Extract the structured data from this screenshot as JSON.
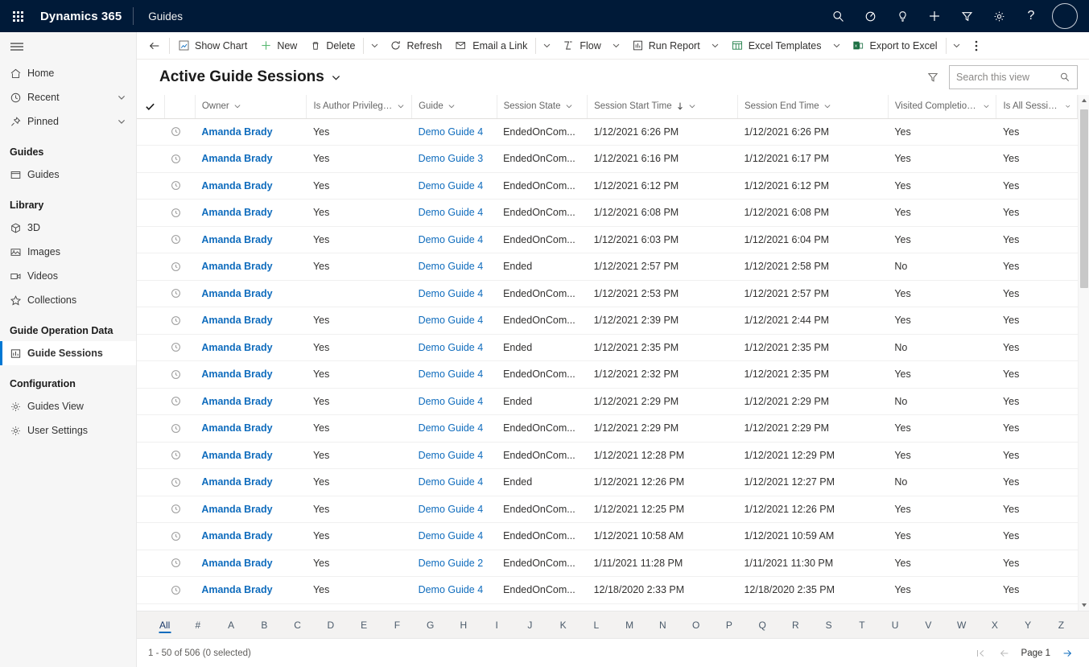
{
  "topbar": {
    "waffle_label": "app-launcher",
    "brand": "Dynamics 365",
    "app_name": "Guides",
    "icons": [
      {
        "name": "search-icon",
        "title": "Search"
      },
      {
        "name": "diagnostics-icon",
        "title": "Diagnostics"
      },
      {
        "name": "lightbulb-icon",
        "title": "Assistant"
      },
      {
        "name": "quick-create-icon",
        "title": "Quick Create"
      },
      {
        "name": "filter-icon",
        "title": "Filter"
      },
      {
        "name": "settings-gear-icon",
        "title": "Settings"
      },
      {
        "name": "help-icon",
        "title": "Help"
      }
    ],
    "avatar_label": "user-avatar"
  },
  "sidebar": {
    "hamburger_label": "Site map",
    "items": [
      {
        "label": "Home",
        "icon": "home-icon",
        "chevron": false,
        "active": false
      },
      {
        "label": "Recent",
        "icon": "clock-icon",
        "chevron": true,
        "active": false
      },
      {
        "label": "Pinned",
        "icon": "pin-icon",
        "chevron": true,
        "active": false
      }
    ],
    "groups": [
      {
        "title": "Guides",
        "items": [
          {
            "label": "Guides",
            "icon": "window-icon",
            "active": false
          }
        ]
      },
      {
        "title": "Library",
        "items": [
          {
            "label": "3D",
            "icon": "cube-icon",
            "active": false
          },
          {
            "label": "Images",
            "icon": "image-icon",
            "active": false
          },
          {
            "label": "Videos",
            "icon": "video-icon",
            "active": false
          },
          {
            "label": "Collections",
            "icon": "star-icon",
            "active": false
          }
        ]
      },
      {
        "title": "Guide Operation Data",
        "items": [
          {
            "label": "Guide Sessions",
            "icon": "chart-icon",
            "active": true
          }
        ]
      },
      {
        "title": "Configuration",
        "items": [
          {
            "label": "Guides View",
            "icon": "gear-icon",
            "active": false
          },
          {
            "label": "User Settings",
            "icon": "gear-icon",
            "active": false
          }
        ]
      }
    ]
  },
  "commandbar": {
    "back_label": "back-arrow",
    "buttons": [
      {
        "label": "Show Chart",
        "icon": "show-chart-icon",
        "caret": false
      },
      {
        "label": "New",
        "icon": "plus-icon",
        "caret": false
      },
      {
        "label": "Delete",
        "icon": "trash-icon",
        "caret": true,
        "divider_before_caret": true
      },
      {
        "label": "Refresh",
        "icon": "refresh-icon",
        "caret": false
      },
      {
        "label": "Email a Link",
        "icon": "email-link-icon",
        "caret": true,
        "divider_before_caret": true
      },
      {
        "label": "Flow",
        "icon": "flow-icon",
        "caret": true
      },
      {
        "label": "Run Report",
        "icon": "run-report-icon",
        "caret": true
      },
      {
        "label": "Excel Templates",
        "icon": "excel-templates-icon",
        "caret": true
      },
      {
        "label": "Export to Excel",
        "icon": "excel-export-icon",
        "caret": true,
        "divider_before_caret": true
      }
    ],
    "overflow_label": "more-commands"
  },
  "view": {
    "title": "Active Guide Sessions",
    "title_chevron": "chevron-down-icon",
    "filter_icon": "filter-funnel-icon"
  },
  "search": {
    "placeholder": "Search this view",
    "value": "",
    "icon": "search-icon"
  },
  "grid": {
    "select_all_checked": true,
    "columns": [
      {
        "key": "owner",
        "label": "Owner",
        "sorted": false
      },
      {
        "key": "is_author_privileged",
        "label": "Is Author Privileged",
        "sorted": false
      },
      {
        "key": "guide",
        "label": "Guide",
        "sorted": false
      },
      {
        "key": "session_state",
        "label": "Session State",
        "sorted": false
      },
      {
        "key": "session_start_time",
        "label": "Session Start Time",
        "sorted": true,
        "sort_dir": "desc"
      },
      {
        "key": "session_end_time",
        "label": "Session End Time",
        "sorted": false
      },
      {
        "key": "visited_completion",
        "label": "Visited Completion S...",
        "sorted": false
      },
      {
        "key": "is_all_session",
        "label": "Is All Session Da...",
        "sorted": false
      }
    ],
    "rows": [
      {
        "owner": "Amanda Brady",
        "is_author_privileged": "Yes",
        "guide": "Demo Guide 4",
        "session_state": "EndedOnCom...",
        "session_start_time": "1/12/2021 6:26 PM",
        "session_end_time": "1/12/2021 6:26 PM",
        "visited_completion": "Yes",
        "is_all_session": "Yes"
      },
      {
        "owner": "Amanda Brady",
        "is_author_privileged": "Yes",
        "guide": "Demo Guide 3",
        "session_state": "EndedOnCom...",
        "session_start_time": "1/12/2021 6:16 PM",
        "session_end_time": "1/12/2021 6:17 PM",
        "visited_completion": "Yes",
        "is_all_session": "Yes"
      },
      {
        "owner": "Amanda Brady",
        "is_author_privileged": "Yes",
        "guide": "Demo Guide 4",
        "session_state": "EndedOnCom...",
        "session_start_time": "1/12/2021 6:12 PM",
        "session_end_time": "1/12/2021 6:12 PM",
        "visited_completion": "Yes",
        "is_all_session": "Yes"
      },
      {
        "owner": "Amanda Brady",
        "is_author_privileged": "Yes",
        "guide": "Demo Guide 4",
        "session_state": "EndedOnCom...",
        "session_start_time": "1/12/2021 6:08 PM",
        "session_end_time": "1/12/2021 6:08 PM",
        "visited_completion": "Yes",
        "is_all_session": "Yes"
      },
      {
        "owner": "Amanda Brady",
        "is_author_privileged": "Yes",
        "guide": "Demo Guide 4",
        "session_state": "EndedOnCom...",
        "session_start_time": "1/12/2021 6:03 PM",
        "session_end_time": "1/12/2021 6:04 PM",
        "visited_completion": "Yes",
        "is_all_session": "Yes"
      },
      {
        "owner": "Amanda Brady",
        "is_author_privileged": "Yes",
        "guide": "Demo Guide 4",
        "session_state": "Ended",
        "session_start_time": "1/12/2021 2:57 PM",
        "session_end_time": "1/12/2021 2:58 PM",
        "visited_completion": "No",
        "is_all_session": "Yes"
      },
      {
        "owner": "Amanda Brady",
        "is_author_privileged": "",
        "guide": "Demo Guide 4",
        "session_state": "EndedOnCom...",
        "session_start_time": "1/12/2021 2:53 PM",
        "session_end_time": "1/12/2021 2:57 PM",
        "visited_completion": "Yes",
        "is_all_session": "Yes"
      },
      {
        "owner": "Amanda Brady",
        "is_author_privileged": "Yes",
        "guide": "Demo Guide 4",
        "session_state": "EndedOnCom...",
        "session_start_time": "1/12/2021 2:39 PM",
        "session_end_time": "1/12/2021 2:44 PM",
        "visited_completion": "Yes",
        "is_all_session": "Yes"
      },
      {
        "owner": "Amanda Brady",
        "is_author_privileged": "Yes",
        "guide": "Demo Guide 4",
        "session_state": "Ended",
        "session_start_time": "1/12/2021 2:35 PM",
        "session_end_time": "1/12/2021 2:35 PM",
        "visited_completion": "No",
        "is_all_session": "Yes"
      },
      {
        "owner": "Amanda Brady",
        "is_author_privileged": "Yes",
        "guide": "Demo Guide 4",
        "session_state": "EndedOnCom...",
        "session_start_time": "1/12/2021 2:32 PM",
        "session_end_time": "1/12/2021 2:35 PM",
        "visited_completion": "Yes",
        "is_all_session": "Yes"
      },
      {
        "owner": "Amanda Brady",
        "is_author_privileged": "Yes",
        "guide": "Demo Guide 4",
        "session_state": "Ended",
        "session_start_time": "1/12/2021 2:29 PM",
        "session_end_time": "1/12/2021 2:29 PM",
        "visited_completion": "No",
        "is_all_session": "Yes"
      },
      {
        "owner": "Amanda Brady",
        "is_author_privileged": "Yes",
        "guide": "Demo Guide 4",
        "session_state": "EndedOnCom...",
        "session_start_time": "1/12/2021 2:29 PM",
        "session_end_time": "1/12/2021 2:29 PM",
        "visited_completion": "Yes",
        "is_all_session": "Yes"
      },
      {
        "owner": "Amanda Brady",
        "is_author_privileged": "Yes",
        "guide": "Demo Guide 4",
        "session_state": "EndedOnCom...",
        "session_start_time": "1/12/2021 12:28 PM",
        "session_end_time": "1/12/2021 12:29 PM",
        "visited_completion": "Yes",
        "is_all_session": "Yes"
      },
      {
        "owner": "Amanda Brady",
        "is_author_privileged": "Yes",
        "guide": "Demo Guide 4",
        "session_state": "Ended",
        "session_start_time": "1/12/2021 12:26 PM",
        "session_end_time": "1/12/2021 12:27 PM",
        "visited_completion": "No",
        "is_all_session": "Yes"
      },
      {
        "owner": "Amanda Brady",
        "is_author_privileged": "Yes",
        "guide": "Demo Guide 4",
        "session_state": "EndedOnCom...",
        "session_start_time": "1/12/2021 12:25 PM",
        "session_end_time": "1/12/2021 12:26 PM",
        "visited_completion": "Yes",
        "is_all_session": "Yes"
      },
      {
        "owner": "Amanda Brady",
        "is_author_privileged": "Yes",
        "guide": "Demo Guide 4",
        "session_state": "EndedOnCom...",
        "session_start_time": "1/12/2021 10:58 AM",
        "session_end_time": "1/12/2021 10:59 AM",
        "visited_completion": "Yes",
        "is_all_session": "Yes"
      },
      {
        "owner": "Amanda Brady",
        "is_author_privileged": "Yes",
        "guide": "Demo Guide 2",
        "session_state": "EndedOnCom...",
        "session_start_time": "1/11/2021 11:28 PM",
        "session_end_time": "1/11/2021 11:30 PM",
        "visited_completion": "Yes",
        "is_all_session": "Yes"
      },
      {
        "owner": "Amanda Brady",
        "is_author_privileged": "Yes",
        "guide": "Demo Guide 4",
        "session_state": "EndedOnCom...",
        "session_start_time": "12/18/2020 2:33 PM",
        "session_end_time": "12/18/2020 2:35 PM",
        "visited_completion": "Yes",
        "is_all_session": "Yes"
      }
    ]
  },
  "alphabet_bar": {
    "active": "All",
    "items": [
      "All",
      "#",
      "A",
      "B",
      "C",
      "D",
      "E",
      "F",
      "G",
      "H",
      "I",
      "J",
      "K",
      "L",
      "M",
      "N",
      "O",
      "P",
      "Q",
      "R",
      "S",
      "T",
      "U",
      "V",
      "W",
      "X",
      "Y",
      "Z"
    ]
  },
  "footer": {
    "status": "1 - 50 of 506 (0 selected)",
    "page_label": "Page 1",
    "first_icon": "first-page-icon",
    "prev_icon": "previous-page-icon",
    "next_icon": "next-page-icon"
  },
  "colors": {
    "topbar_bg": "#001a38",
    "accent": "#0f6cbd",
    "sidebar_bg": "#f6f6f6",
    "alpha_bar_bg": "#f3f2f1"
  }
}
